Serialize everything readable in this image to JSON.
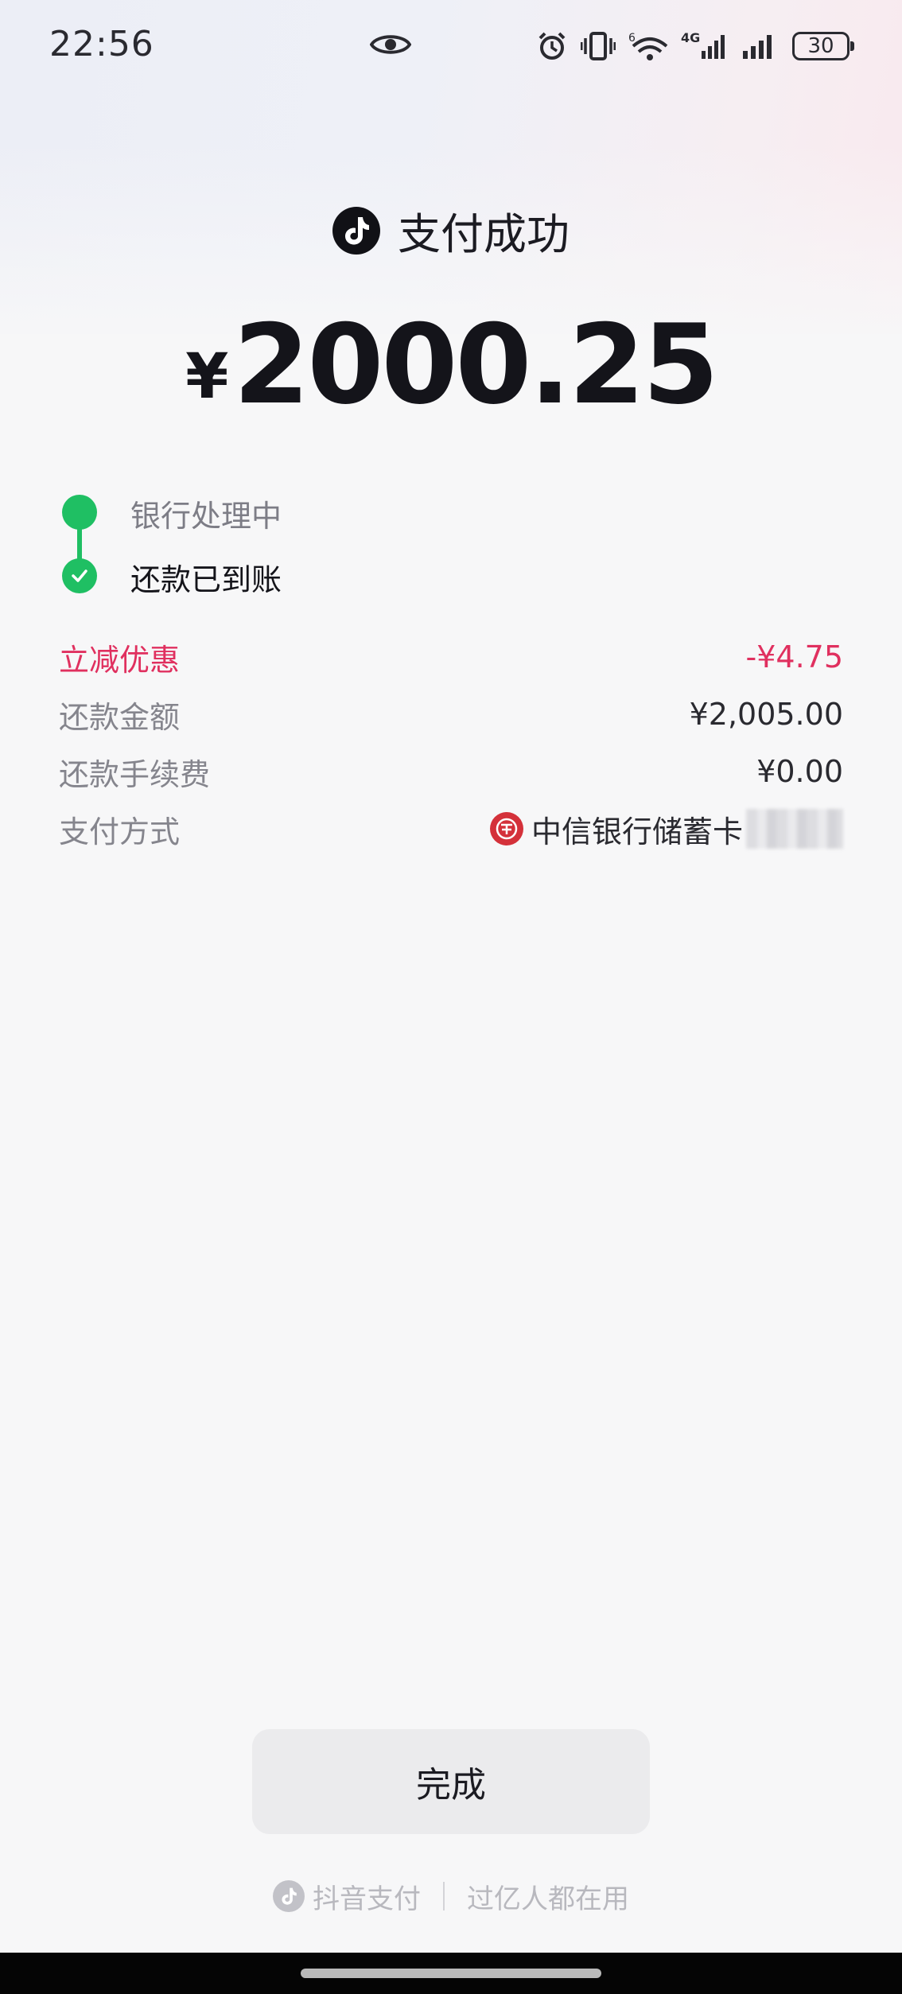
{
  "status_bar": {
    "time": "22:56",
    "network": "4G",
    "wifi_label": "6",
    "battery": "30"
  },
  "header": {
    "title": "支付成功"
  },
  "amount": {
    "symbol": "¥",
    "value": "2000.25"
  },
  "progress": {
    "steps": [
      {
        "label": "银行处理中",
        "state": "done"
      },
      {
        "label": "还款已到账",
        "state": "current"
      }
    ]
  },
  "details": {
    "rows": [
      {
        "label": "立减优惠",
        "value": "-¥4.75"
      },
      {
        "label": "还款金额",
        "value": "¥2,005.00"
      },
      {
        "label": "还款手续费",
        "value": "¥0.00"
      },
      {
        "label": "支付方式",
        "value": "中信银行储蓄卡"
      }
    ]
  },
  "actions": {
    "done_label": "完成"
  },
  "footer": {
    "brand": "抖音支付",
    "slogan": "过亿人都在用"
  },
  "colors": {
    "accent_green": "#1fbf63",
    "discount_red": "#e0305f",
    "bank_red": "#d4313a"
  }
}
